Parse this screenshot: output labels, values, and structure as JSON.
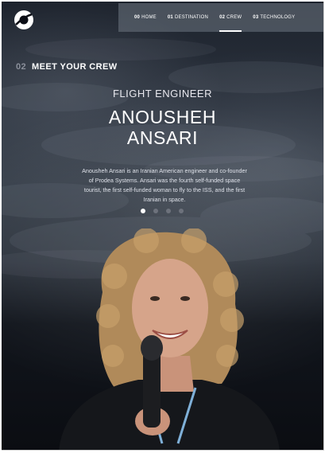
{
  "nav": {
    "items": [
      {
        "num": "00",
        "label": "HOME"
      },
      {
        "num": "01",
        "label": "DESTINATION"
      },
      {
        "num": "02",
        "label": "CREW"
      },
      {
        "num": "03",
        "label": "TECHNOLOGY"
      }
    ],
    "active_index": 2
  },
  "heading": {
    "num": "02",
    "label": "MEET YOUR CREW"
  },
  "crew": {
    "role": "FLIGHT ENGINEER",
    "name_line1": "ANOUSHEH",
    "name_line2": "ANSARI",
    "bio": "Anousheh Ansari is an Iranian American engineer and co-founder of Prodea Systems. Ansari was the fourth self-funded space tourist, the first self-funded woman to fly to the ISS, and the first Iranian in space."
  },
  "slider": {
    "count": 4,
    "active_index": 0
  },
  "colors": {
    "nav_bg": "#6e7682",
    "active_dot": "#ffffff",
    "inactive_dot": "#6d727c",
    "heading_num": "#8a8f9a"
  },
  "icons": {
    "logo": "planet-logo-icon"
  }
}
